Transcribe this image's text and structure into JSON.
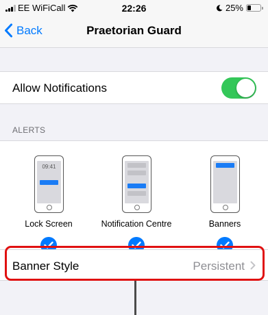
{
  "status_bar": {
    "carrier": "EE WiFiCall",
    "time": "22:26",
    "battery_percent": "25%",
    "battery_level": 0.25,
    "icons": [
      "signal-icon",
      "wifi-icon",
      "do-not-disturb-moon-icon",
      "battery-icon"
    ]
  },
  "nav": {
    "back_label": "Back",
    "title": "Praetorian Guard",
    "back_icon": "chevron-left-icon"
  },
  "allow_notifications": {
    "label": "Allow Notifications",
    "enabled": true,
    "toggle_color": "#34c759"
  },
  "alerts": {
    "header": "ALERTS",
    "options": [
      {
        "label": "Lock Screen",
        "preview_time": "09:41",
        "checked": true
      },
      {
        "label": "Notification Centre",
        "checked": true
      },
      {
        "label": "Banners",
        "checked": true
      }
    ],
    "check_color": "#007aff"
  },
  "banner_style": {
    "label": "Banner Style",
    "value": "Persistent",
    "chevron_icon": "chevron-right-icon"
  },
  "highlight": {
    "target": "banner-style-row",
    "color": "#e01010"
  }
}
